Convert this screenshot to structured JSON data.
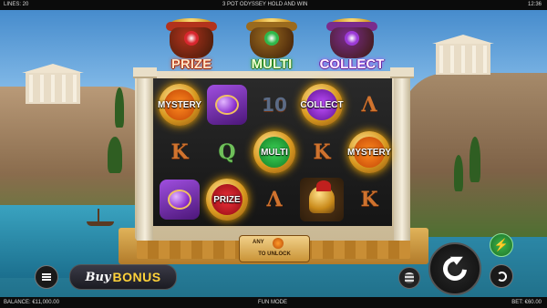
{
  "top_bar": {
    "lines": "LINES: 20",
    "title": "3 POT ODYSSEY HOLD AND WIN",
    "clock": "12:36"
  },
  "pots": [
    {
      "label": "PRIZE",
      "gem_color": "#d8262e",
      "pot_color": "#b2321c"
    },
    {
      "label": "MULTI",
      "gem_color": "#2fb84a",
      "pot_color": "#9a6a1e"
    },
    {
      "label": "COLLECT",
      "gem_color": "#9b3ad6",
      "pot_color": "#7a2c8c"
    }
  ],
  "reels": [
    [
      {
        "kind": "coin",
        "color": "orange",
        "label": "MYSTERY"
      },
      {
        "kind": "letter",
        "label": "K"
      },
      {
        "kind": "grapes"
      }
    ],
    [
      {
        "kind": "grapes"
      },
      {
        "kind": "letter",
        "label": "Q",
        "style": "q"
      },
      {
        "kind": "coin",
        "color": "red",
        "label": "PRIZE"
      }
    ],
    [
      {
        "kind": "letter",
        "label": "10",
        "style": "ten"
      },
      {
        "kind": "coin",
        "color": "green",
        "label": "MULTI"
      },
      {
        "kind": "letter",
        "label": "Λ"
      }
    ],
    [
      {
        "kind": "coin",
        "color": "purple",
        "label": "COLLECT"
      },
      {
        "kind": "letter",
        "label": "K"
      },
      {
        "kind": "helmet"
      }
    ],
    [
      {
        "kind": "letter",
        "label": "Λ"
      },
      {
        "kind": "coin",
        "color": "orange",
        "label": "MYSTERY"
      },
      {
        "kind": "letter",
        "label": "K"
      }
    ]
  ],
  "unlock_panel": {
    "line1": "ANY",
    "line2": "TO UNLOCK"
  },
  "buttons": {
    "buy_word": "Buy",
    "bonus_word": "BONUS",
    "turbo_symbol": "⚡"
  },
  "bottom_bar": {
    "balance": "BALANCE: €11,000.00",
    "mode": "FUN MODE",
    "bet": "BET: €60.00"
  },
  "colors": {
    "accent_gold": "#d8981f",
    "turbo_green": "#3bb54a"
  }
}
